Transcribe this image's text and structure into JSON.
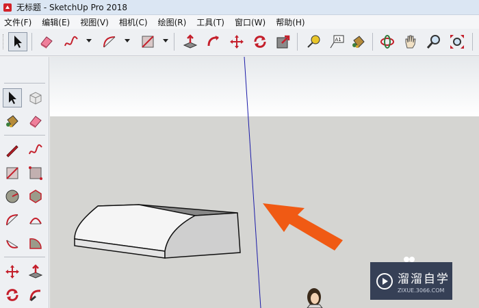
{
  "window": {
    "title": "无标题 - SketchUp Pro 2018"
  },
  "menu": [
    "文件(F)",
    "编辑(E)",
    "视图(V)",
    "相机(C)",
    "绘图(R)",
    "工具(T)",
    "窗口(W)",
    "帮助(H)"
  ],
  "toolbar": {
    "tools": [
      "select",
      "eraser",
      "freehand",
      "arc",
      "rectangle",
      "push-pull",
      "follow-me",
      "move",
      "rotate",
      "scale",
      "tape-measure",
      "text",
      "paint-bucket",
      "orbit",
      "pan",
      "zoom",
      "zoom-extents"
    ],
    "text_tool_label": "A1"
  },
  "sidebar": {
    "tools": [
      "select",
      "component",
      "paint-bucket",
      "eraser",
      "line",
      "freehand",
      "rectangle",
      "rotated-rectangle",
      "circle",
      "polygon",
      "arc",
      "two-point-arc",
      "three-point-arc",
      "pie",
      "move",
      "push-pull",
      "rotate",
      "follow-me"
    ]
  },
  "watermark": {
    "brand": "溜溜自学",
    "url": "ZIXUE.3066.COM"
  },
  "colors": {
    "accent_arrow": "#f05a14",
    "axis_blue": "#1a1aa8",
    "ground": "#d5d5d2",
    "watermark_bg": "#202b44"
  }
}
